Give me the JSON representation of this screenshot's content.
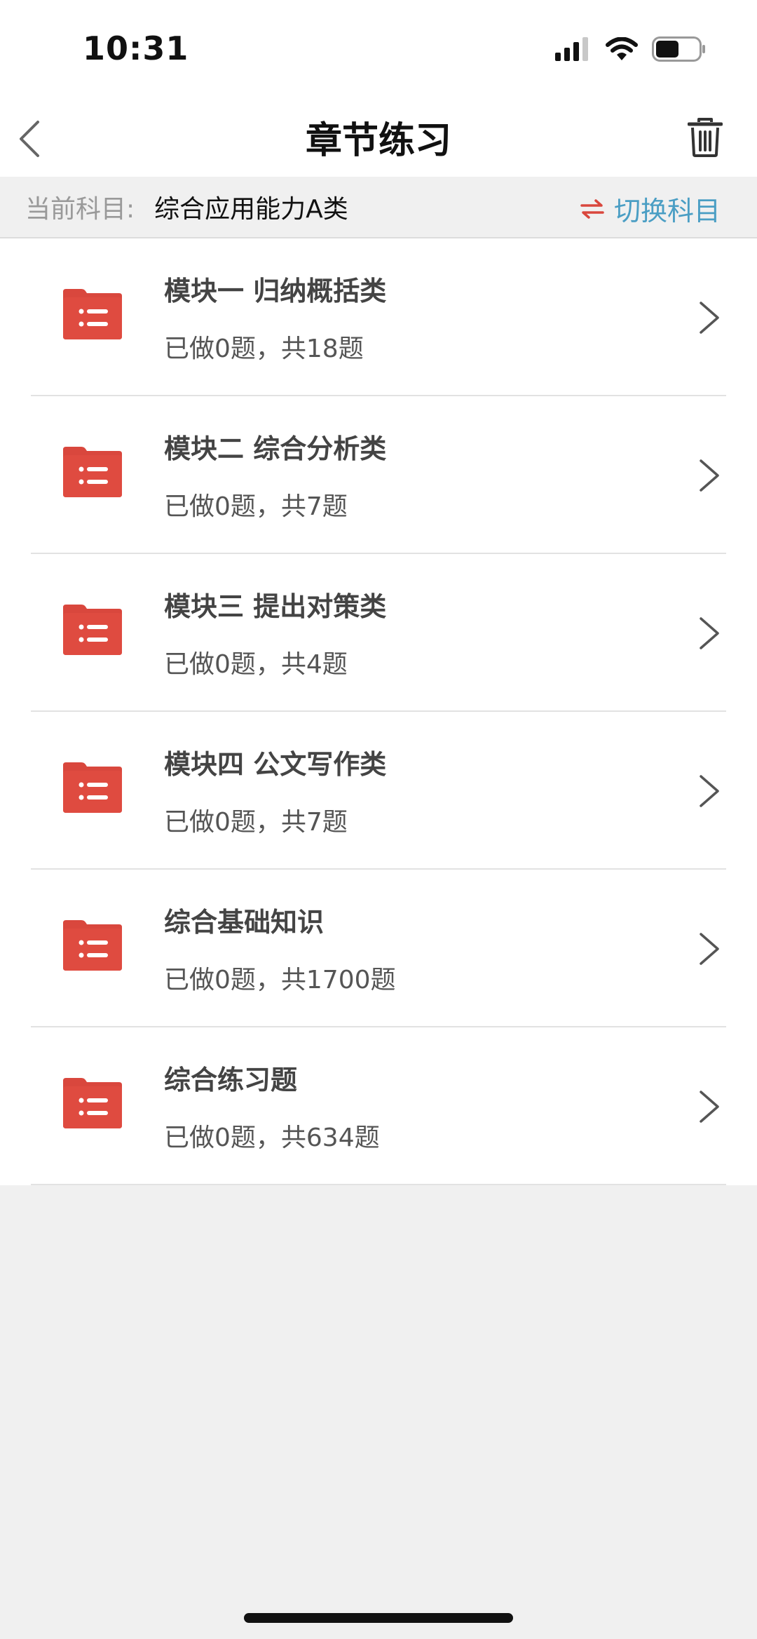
{
  "status_bar": {
    "time": "10:31"
  },
  "nav": {
    "title": "章节练习"
  },
  "subject_bar": {
    "label": "当前科目:",
    "value": "综合应用能力A类",
    "switch_label": "切换科目"
  },
  "colors": {
    "accent_red": "#d9473d",
    "switch_blue": "#4a9ec4"
  },
  "items": [
    {
      "title": "模块一 归纳概括类",
      "progress": "已做0题，共18题"
    },
    {
      "title": "模块二 综合分析类",
      "progress": "已做0题，共7题"
    },
    {
      "title": "模块三 提出对策类",
      "progress": "已做0题，共4题"
    },
    {
      "title": "模块四 公文写作类",
      "progress": "已做0题，共7题"
    },
    {
      "title": "综合基础知识",
      "progress": "已做0题，共1700题"
    },
    {
      "title": "综合练习题",
      "progress": "已做0题，共634题"
    }
  ]
}
